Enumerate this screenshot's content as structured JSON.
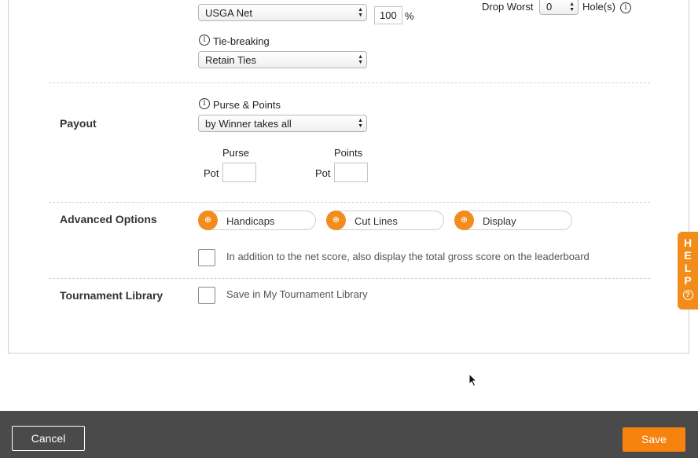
{
  "scoring": {
    "method_value": "USGA Net",
    "percent_value": "100",
    "percent_symbol": "%",
    "drop_worst_label": "Drop Worst",
    "drop_worst_value": "0",
    "holes_label": "Hole(s)"
  },
  "tie_breaking": {
    "label": "Tie-breaking",
    "value": "Retain Ties"
  },
  "payout": {
    "title": "Payout",
    "purse_points_label": "Purse & Points",
    "purse_points_value": "by Winner takes all",
    "purse_header": "Purse",
    "points_header": "Points",
    "pot_label": "Pot",
    "purse_pot_value": "",
    "points_pot_value": ""
  },
  "advanced": {
    "title": "Advanced Options",
    "pills": [
      {
        "label": "Handicaps"
      },
      {
        "label": "Cut Lines"
      },
      {
        "label": "Display"
      }
    ],
    "gross_score_label": "In addition to the net score, also display the total gross score on the leaderboard"
  },
  "library": {
    "title": "Tournament Library",
    "save_label": "Save in My Tournament Library"
  },
  "help": {
    "letters": [
      "H",
      "E",
      "L",
      "P"
    ],
    "q": "?"
  },
  "footer": {
    "cancel_label": "Cancel",
    "save_label": "Save"
  },
  "colors": {
    "accent": "#f28c1a",
    "footer_bg": "#4a4a4a"
  }
}
